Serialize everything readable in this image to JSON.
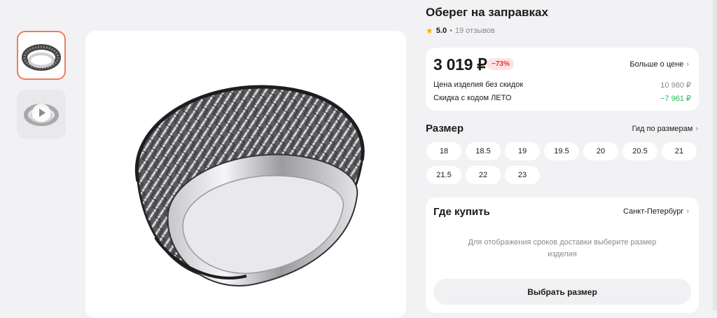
{
  "product": {
    "title": "Оберег на заправках",
    "rating": "5.0",
    "separator": "•",
    "reviews": "19 отзывов",
    "star_icon": "★"
  },
  "price": {
    "current": "3 019 ₽",
    "discount_badge": "−73%",
    "more_link": "Больше о цене",
    "rows": [
      {
        "label": "Цена изделия без скидок",
        "value": "10 980 ₽"
      },
      {
        "label": "Скидка с кодом ЛЕТО",
        "value": "−7 961 ₽"
      }
    ]
  },
  "sizes": {
    "title": "Размер",
    "guide_link": "Гид по размерам",
    "options": [
      "18",
      "18.5",
      "19",
      "19.5",
      "20",
      "20.5",
      "21",
      "21.5",
      "22",
      "23"
    ]
  },
  "buy": {
    "title": "Где купить",
    "city": "Санкт-Петербург",
    "hint": "Для отображения сроков доставки выберите размер изделия",
    "select_button": "Выбрать размер"
  },
  "chevron_glyph": "›",
  "colors": {
    "accent_border": "#f07b5c",
    "discount_red": "#e0343a",
    "discount_green": "#2db35d",
    "star": "#f5b400"
  }
}
